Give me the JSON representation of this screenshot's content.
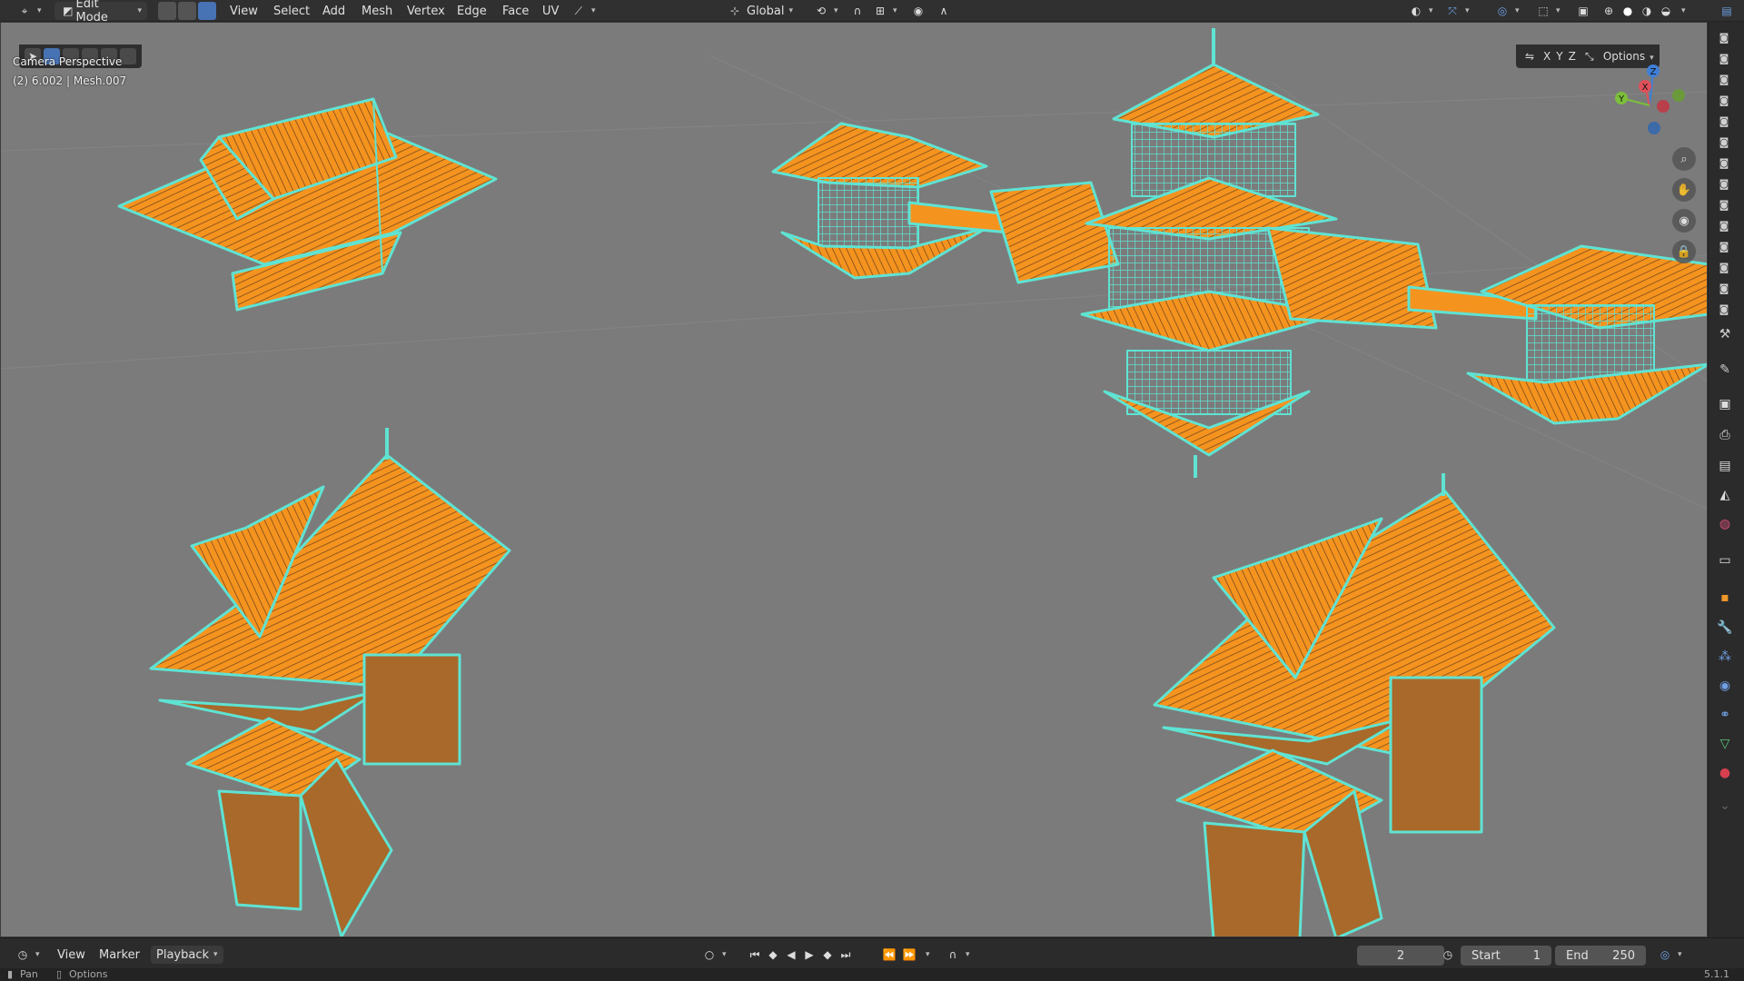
{
  "header": {
    "editor_icon": "viewport-editor-icon",
    "mode": "Edit Mode",
    "menus": [
      "View",
      "Select",
      "Add",
      "Mesh",
      "Vertex",
      "Edge",
      "Face",
      "UV"
    ],
    "transform_orientation": "Global",
    "options_label": "Options",
    "axes": [
      "X",
      "Y",
      "Z"
    ]
  },
  "viewport": {
    "view_name": "Camera Perspective",
    "object_info": "(2) 6.002 | Mesh.007",
    "gizmo": {
      "x": "X",
      "y": "Y",
      "z": "Z"
    }
  },
  "timeline": {
    "menus": [
      "View",
      "Marker",
      "Playback"
    ],
    "current_frame": "2",
    "start_label": "Start",
    "start_value": "1",
    "end_label": "End",
    "end_value": "250"
  },
  "status": {
    "left_action": "Pan",
    "right_action": "Options",
    "version": "5.1.1"
  },
  "colors": {
    "wire": "#5fe3d3",
    "face": "#f5931f",
    "face_dark": "#a8692b",
    "bg": "#7b7b7b",
    "accent": "#4772b3"
  }
}
